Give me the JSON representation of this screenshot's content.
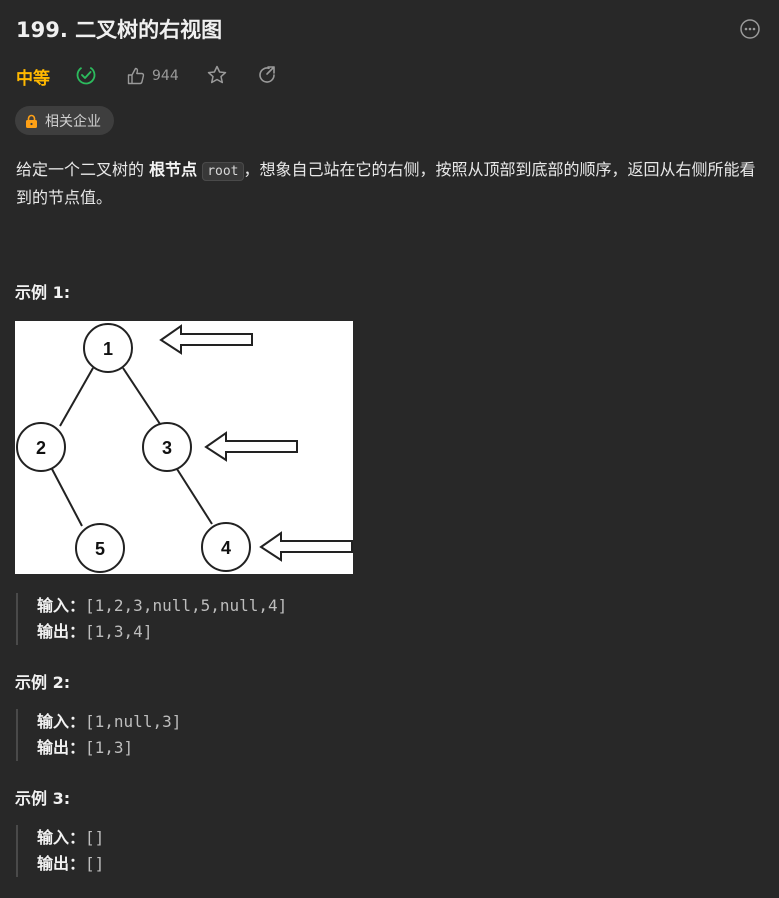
{
  "problem": {
    "title": "199. 二叉树的右视图",
    "difficulty": "中等",
    "likes": "944",
    "company_tag": "相关企业"
  },
  "description": {
    "part1": "给定一个二叉树的 ",
    "bold": "根节点",
    "code": "root",
    "part2": "，想象自己站在它的右侧，按照从顶部到底部的顺序，返回从右侧所能看到的节点值。"
  },
  "examples": [
    {
      "title": "示例 1:",
      "input_label": "输入：",
      "input": "[1,2,3,null,5,null,4]",
      "output_label": "输出：",
      "output": "[1,3,4]",
      "tree_nodes": [
        "1",
        "2",
        "3",
        "5",
        "4"
      ]
    },
    {
      "title": "示例 2:",
      "input_label": "输入：",
      "input": "[1,null,3]",
      "output_label": "输出：",
      "output": "[1,3]"
    },
    {
      "title": "示例 3:",
      "input_label": "输入：",
      "input": "[]",
      "output_label": "输出：",
      "output": "[]"
    }
  ],
  "colors": {
    "background": "#282828",
    "difficulty": "#ffb800",
    "solved": "#2cbb5d"
  },
  "icons": [
    "more-icon",
    "solved-check-icon",
    "thumbs-up-icon",
    "star-icon",
    "share-icon",
    "lock-icon"
  ]
}
